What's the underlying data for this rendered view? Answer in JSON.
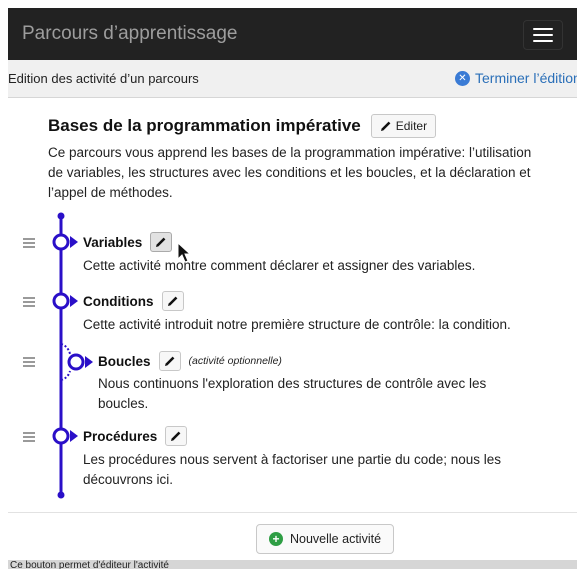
{
  "navbar": {
    "brand": "Parcours d’apprentissage",
    "menu_icon": "hamburger-icon"
  },
  "subbar": {
    "title": "Edition des activité d’un parcours",
    "finish_label": "Terminer l’édition",
    "finish_icon": "close-circle-icon"
  },
  "course": {
    "title": "Bases de la programmation impérative",
    "edit_label": "Editer",
    "description": "Ce parcours vous apprend les bases de la programmation impérative: l’utilisation de variables, les structures avec les conditions et les boucles, et la déclaration et l’appel de méthodes."
  },
  "activities": [
    {
      "title": "Variables",
      "optional_label": "",
      "description": "Cette activité montre comment déclarer et assigner des variables.",
      "optional": false
    },
    {
      "title": "Conditions",
      "optional_label": "",
      "description": "Cette activité introduit notre première structure de contrôle: la condition.",
      "optional": false
    },
    {
      "title": "Boucles",
      "optional_label": "(activité optionnelle)",
      "description": "Nous continuons l'exploration des structures de contrôle avec les boucles.",
      "optional": true
    },
    {
      "title": "Procédures",
      "optional_label": "",
      "description": "Les procédures nous servent à factoriser une partie du code; nous les découvrons ici.",
      "optional": false
    }
  ],
  "footer": {
    "new_activity_label": "Nouvelle activité",
    "new_activity_icon": "plus-circle-icon"
  },
  "status_text": "Ce bouton permet d'éditeur l'activité",
  "colors": {
    "timeline": "#2a0fc8",
    "navbar_bg": "#222222",
    "link": "#2a6fb8",
    "add_green": "#2e9e44"
  }
}
